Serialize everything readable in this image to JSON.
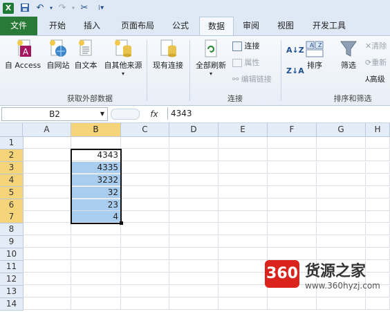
{
  "quick_access": {
    "icons": [
      "excel-icon",
      "save-icon",
      "undo-icon",
      "redo-icon",
      "customize-icon"
    ]
  },
  "tabs": [
    {
      "label": "文件"
    },
    {
      "label": "开始"
    },
    {
      "label": "插入"
    },
    {
      "label": "页面布局"
    },
    {
      "label": "公式"
    },
    {
      "label": "数据"
    },
    {
      "label": "审阅"
    },
    {
      "label": "视图"
    },
    {
      "label": "开发工具"
    }
  ],
  "ribbon": {
    "get_external": {
      "access": "自 Access",
      "web": "自网站",
      "text": "自文本",
      "other": "自其他来源",
      "existing": "现有连接",
      "group_label": "获取外部数据"
    },
    "connections": {
      "refresh_all": "全部刷新",
      "connections": "连接",
      "properties": "属性",
      "edit_links": "编辑链接",
      "group_label": "连接"
    },
    "sort_filter": {
      "sort": "排序",
      "filter": "筛选",
      "clear": "清除",
      "reapply": "重新",
      "advanced": "高级",
      "group_label": "排序和筛选"
    }
  },
  "formula_bar": {
    "name_box": "B2",
    "fx_label": "fx",
    "value": "4343"
  },
  "sheet": {
    "columns": [
      "A",
      "B",
      "C",
      "D",
      "E",
      "F",
      "G",
      "H"
    ],
    "rows": [
      "1",
      "2",
      "3",
      "4",
      "5",
      "6",
      "7",
      "8",
      "9",
      "10",
      "11",
      "12",
      "13",
      "14"
    ],
    "b_values": [
      "",
      "4343",
      "4335",
      "3232",
      "32",
      "23",
      "4",
      "",
      "",
      "",
      "",
      "",
      "",
      ""
    ]
  },
  "watermark": {
    "badge": "360",
    "name": "货源之家",
    "url": "www.360hyzj.com"
  },
  "colors": {
    "selection": "#a9cdef",
    "header_selected": "#f6d57a",
    "file_tab": "#2a7a37",
    "brand_red": "#d9231c"
  }
}
